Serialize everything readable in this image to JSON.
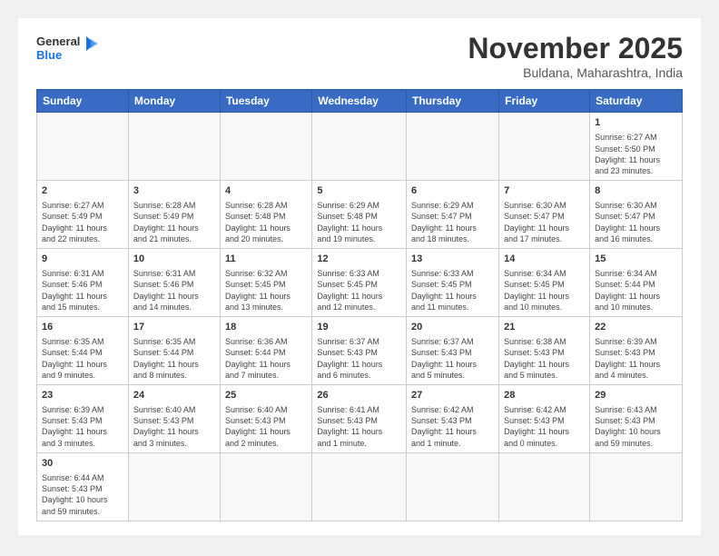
{
  "header": {
    "logo_general": "General",
    "logo_blue": "Blue",
    "month": "November 2025",
    "location": "Buldana, Maharashtra, India"
  },
  "days_of_week": [
    "Sunday",
    "Monday",
    "Tuesday",
    "Wednesday",
    "Thursday",
    "Friday",
    "Saturday"
  ],
  "weeks": [
    [
      {
        "day": "",
        "info": ""
      },
      {
        "day": "",
        "info": ""
      },
      {
        "day": "",
        "info": ""
      },
      {
        "day": "",
        "info": ""
      },
      {
        "day": "",
        "info": ""
      },
      {
        "day": "",
        "info": ""
      },
      {
        "day": "1",
        "info": "Sunrise: 6:27 AM\nSunset: 5:50 PM\nDaylight: 11 hours\nand 23 minutes."
      }
    ],
    [
      {
        "day": "2",
        "info": "Sunrise: 6:27 AM\nSunset: 5:49 PM\nDaylight: 11 hours\nand 22 minutes."
      },
      {
        "day": "3",
        "info": "Sunrise: 6:28 AM\nSunset: 5:49 PM\nDaylight: 11 hours\nand 21 minutes."
      },
      {
        "day": "4",
        "info": "Sunrise: 6:28 AM\nSunset: 5:48 PM\nDaylight: 11 hours\nand 20 minutes."
      },
      {
        "day": "5",
        "info": "Sunrise: 6:29 AM\nSunset: 5:48 PM\nDaylight: 11 hours\nand 19 minutes."
      },
      {
        "day": "6",
        "info": "Sunrise: 6:29 AM\nSunset: 5:47 PM\nDaylight: 11 hours\nand 18 minutes."
      },
      {
        "day": "7",
        "info": "Sunrise: 6:30 AM\nSunset: 5:47 PM\nDaylight: 11 hours\nand 17 minutes."
      },
      {
        "day": "8",
        "info": "Sunrise: 6:30 AM\nSunset: 5:47 PM\nDaylight: 11 hours\nand 16 minutes."
      }
    ],
    [
      {
        "day": "9",
        "info": "Sunrise: 6:31 AM\nSunset: 5:46 PM\nDaylight: 11 hours\nand 15 minutes."
      },
      {
        "day": "10",
        "info": "Sunrise: 6:31 AM\nSunset: 5:46 PM\nDaylight: 11 hours\nand 14 minutes."
      },
      {
        "day": "11",
        "info": "Sunrise: 6:32 AM\nSunset: 5:45 PM\nDaylight: 11 hours\nand 13 minutes."
      },
      {
        "day": "12",
        "info": "Sunrise: 6:33 AM\nSunset: 5:45 PM\nDaylight: 11 hours\nand 12 minutes."
      },
      {
        "day": "13",
        "info": "Sunrise: 6:33 AM\nSunset: 5:45 PM\nDaylight: 11 hours\nand 11 minutes."
      },
      {
        "day": "14",
        "info": "Sunrise: 6:34 AM\nSunset: 5:45 PM\nDaylight: 11 hours\nand 10 minutes."
      },
      {
        "day": "15",
        "info": "Sunrise: 6:34 AM\nSunset: 5:44 PM\nDaylight: 11 hours\nand 10 minutes."
      }
    ],
    [
      {
        "day": "16",
        "info": "Sunrise: 6:35 AM\nSunset: 5:44 PM\nDaylight: 11 hours\nand 9 minutes."
      },
      {
        "day": "17",
        "info": "Sunrise: 6:35 AM\nSunset: 5:44 PM\nDaylight: 11 hours\nand 8 minutes."
      },
      {
        "day": "18",
        "info": "Sunrise: 6:36 AM\nSunset: 5:44 PM\nDaylight: 11 hours\nand 7 minutes."
      },
      {
        "day": "19",
        "info": "Sunrise: 6:37 AM\nSunset: 5:43 PM\nDaylight: 11 hours\nand 6 minutes."
      },
      {
        "day": "20",
        "info": "Sunrise: 6:37 AM\nSunset: 5:43 PM\nDaylight: 11 hours\nand 5 minutes."
      },
      {
        "day": "21",
        "info": "Sunrise: 6:38 AM\nSunset: 5:43 PM\nDaylight: 11 hours\nand 5 minutes."
      },
      {
        "day": "22",
        "info": "Sunrise: 6:39 AM\nSunset: 5:43 PM\nDaylight: 11 hours\nand 4 minutes."
      }
    ],
    [
      {
        "day": "23",
        "info": "Sunrise: 6:39 AM\nSunset: 5:43 PM\nDaylight: 11 hours\nand 3 minutes."
      },
      {
        "day": "24",
        "info": "Sunrise: 6:40 AM\nSunset: 5:43 PM\nDaylight: 11 hours\nand 3 minutes."
      },
      {
        "day": "25",
        "info": "Sunrise: 6:40 AM\nSunset: 5:43 PM\nDaylight: 11 hours\nand 2 minutes."
      },
      {
        "day": "26",
        "info": "Sunrise: 6:41 AM\nSunset: 5:43 PM\nDaylight: 11 hours\nand 1 minute."
      },
      {
        "day": "27",
        "info": "Sunrise: 6:42 AM\nSunset: 5:43 PM\nDaylight: 11 hours\nand 1 minute."
      },
      {
        "day": "28",
        "info": "Sunrise: 6:42 AM\nSunset: 5:43 PM\nDaylight: 11 hours\nand 0 minutes."
      },
      {
        "day": "29",
        "info": "Sunrise: 6:43 AM\nSunset: 5:43 PM\nDaylight: 10 hours\nand 59 minutes."
      }
    ],
    [
      {
        "day": "30",
        "info": "Sunrise: 6:44 AM\nSunset: 5:43 PM\nDaylight: 10 hours\nand 59 minutes."
      },
      {
        "day": "",
        "info": ""
      },
      {
        "day": "",
        "info": ""
      },
      {
        "day": "",
        "info": ""
      },
      {
        "day": "",
        "info": ""
      },
      {
        "day": "",
        "info": ""
      },
      {
        "day": "",
        "info": ""
      }
    ]
  ]
}
